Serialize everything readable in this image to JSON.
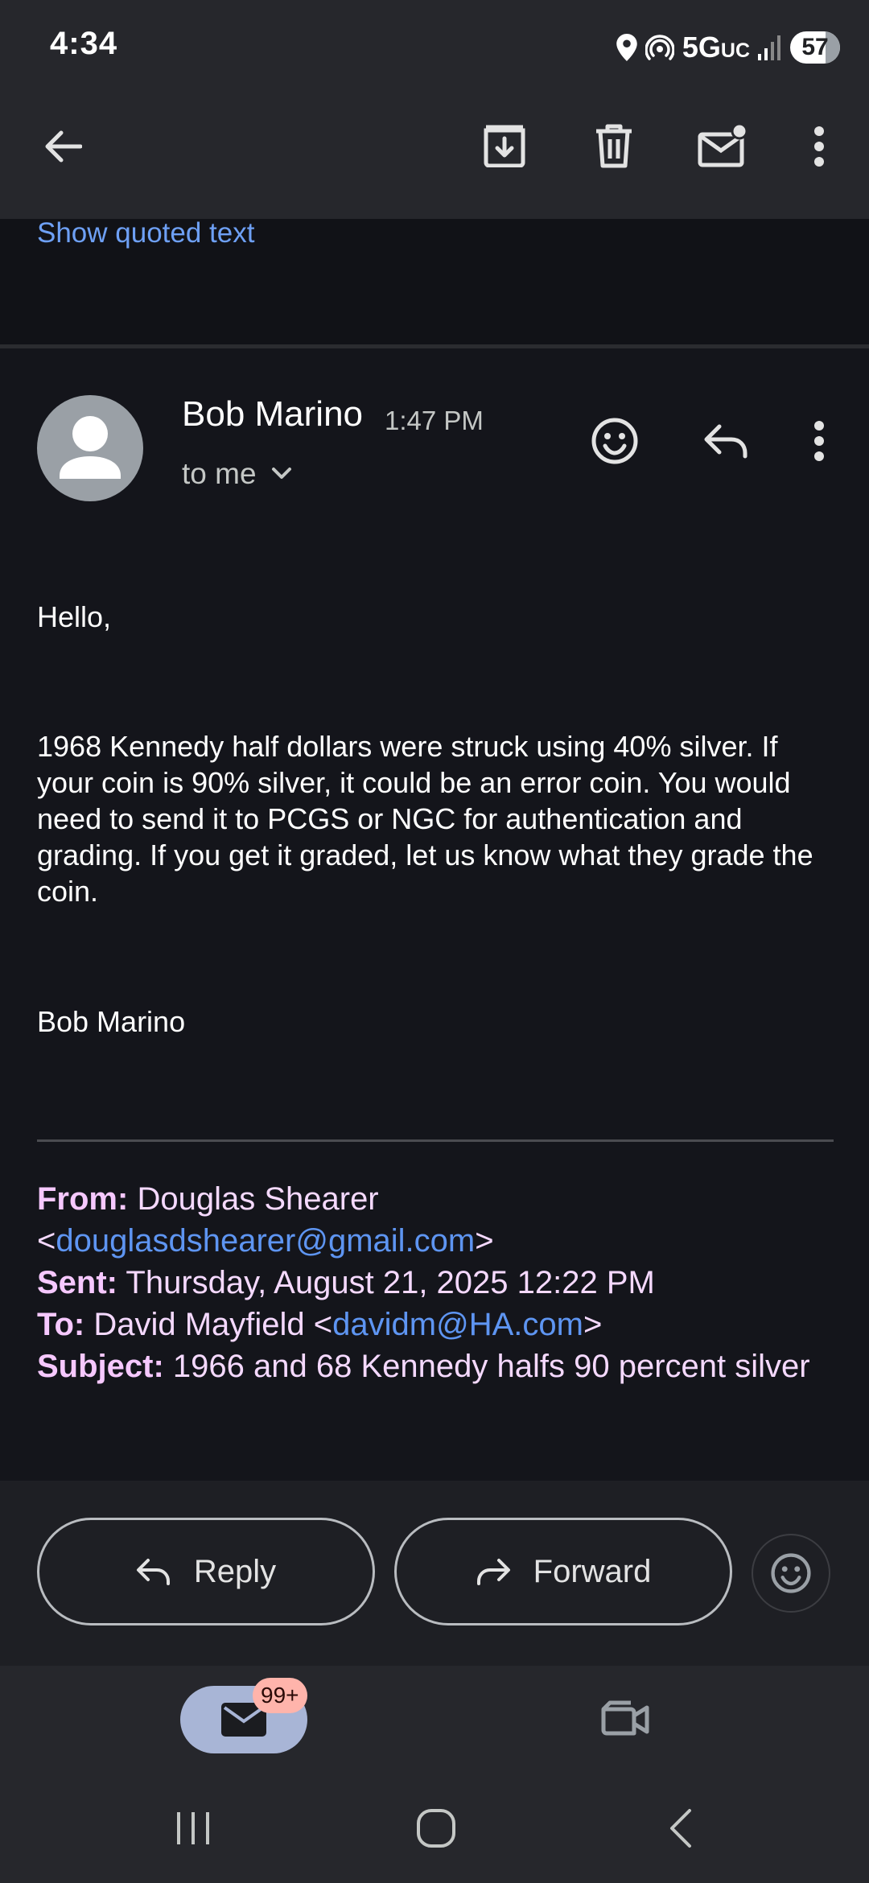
{
  "status_bar": {
    "time": "4:34",
    "network": "5G",
    "network_suffix": "UC",
    "battery": "57"
  },
  "toolbar": {
    "back_icon": "arrow-left-icon",
    "archive_icon": "archive-icon",
    "delete_icon": "trash-icon",
    "mark_unread_icon": "mail-unread-icon",
    "more_icon": "more-vert-icon"
  },
  "thread": {
    "show_quoted_text": "Show quoted text"
  },
  "message": {
    "sender": "Bob Marino",
    "time": "1:47 PM",
    "recipient": "to me",
    "body": {
      "greeting": "Hello,",
      "paragraph": "1968 Kennedy half dollars were struck using 40% silver. If your coin is 90% silver, it could be an error coin. You would need to send it to PCGS or NGC for authentication and grading. If you get it graded, let us know what they grade the coin.",
      "signature": "Bob Marino"
    },
    "quoted_header": {
      "from_label": "From:",
      "from_name": "Douglas Shearer",
      "from_email": "douglasdshearer@gmail.com",
      "sent_label": "Sent:",
      "sent_value": "Thursday, August 21, 2025 12:22 PM",
      "to_label": "To:",
      "to_name": "David Mayfield",
      "to_email": "davidm@HA.com",
      "subject_label": "Subject:",
      "subject_value": "1966 and 68 Kennedy halfs 90 percent silver"
    }
  },
  "actions": {
    "reply": "Reply",
    "forward": "Forward"
  },
  "bottom_nav": {
    "mail_badge": "99+"
  },
  "colors": {
    "background": "#14151b",
    "toolbar": "#26272c",
    "link": "#5e95f2",
    "quote_text": "#f5d9ff",
    "mail_pill": "#a8b5d6",
    "badge": "#ffb4ab"
  }
}
